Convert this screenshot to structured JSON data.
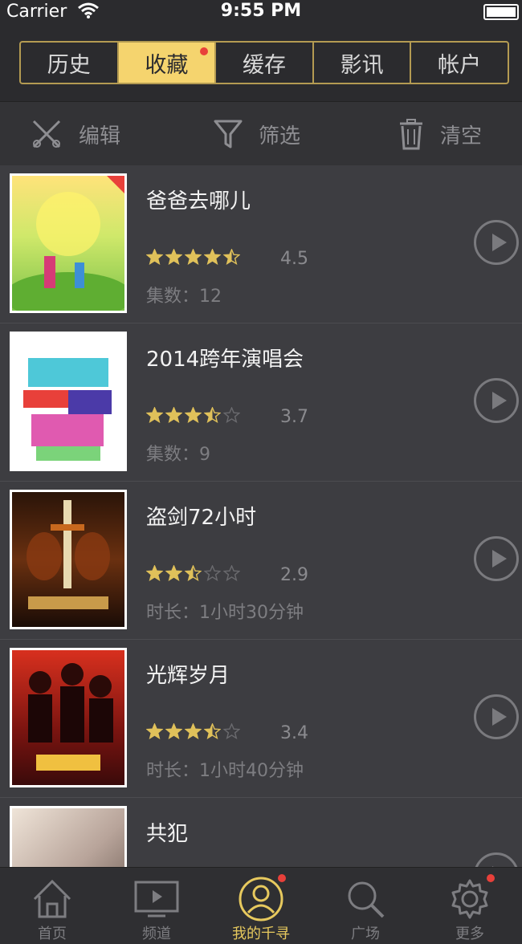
{
  "status_bar": {
    "carrier": "Carrier",
    "time": "9:55 PM"
  },
  "header_tabs": [
    {
      "label": "历史",
      "active": false,
      "badge": false
    },
    {
      "label": "收藏",
      "active": true,
      "badge": true
    },
    {
      "label": "缓存",
      "active": false,
      "badge": false
    },
    {
      "label": "影讯",
      "active": false,
      "badge": false
    },
    {
      "label": "帐户",
      "active": false,
      "badge": false
    }
  ],
  "toolbar": {
    "edit_label": "编辑",
    "filter_label": "筛选",
    "clear_label": "清空"
  },
  "items": [
    {
      "title": "爸爸去哪儿",
      "rating": "4.5",
      "stars": 4.5,
      "meta": "集数：12",
      "poster_icon": "poster-baba-qu-naer",
      "poster_colors": [
        "#7cc24a",
        "#ffe37a"
      ]
    },
    {
      "title": "2014跨年演唱会",
      "rating": "3.7",
      "stars": 3.5,
      "meta": "集数：9",
      "poster_icon": "poster-concert",
      "poster_colors": [
        "#ffffff",
        "#3fb3c8"
      ]
    },
    {
      "title": "盗剑72小时",
      "rating": "2.9",
      "stars": 2.5,
      "meta": "时长：1小时30分钟",
      "poster_icon": "poster-sword",
      "poster_colors": [
        "#1a0c06",
        "#c8681e"
      ]
    },
    {
      "title": "光辉岁月",
      "rating": "3.4",
      "stars": 3.5,
      "meta": "时长：1小时40分钟",
      "poster_icon": "poster-glory",
      "poster_colors": [
        "#b8231c",
        "#3a0a0a"
      ]
    },
    {
      "title": "共犯",
      "rating": "",
      "stars": 0,
      "meta": "",
      "poster_icon": "poster-accomplice",
      "poster_colors": [
        "#d8c8b8",
        "#5a4a42"
      ]
    }
  ],
  "tabbar": [
    {
      "label": "首页",
      "icon": "home-icon",
      "active": false,
      "badge": false
    },
    {
      "label": "频道",
      "icon": "tv-icon",
      "active": false,
      "badge": false
    },
    {
      "label": "我的千寻",
      "icon": "user-circle-icon",
      "active": true,
      "badge": true
    },
    {
      "label": "广场",
      "icon": "search-icon",
      "active": false,
      "badge": false
    },
    {
      "label": "更多",
      "icon": "gear-icon",
      "active": false,
      "badge": true
    }
  ],
  "colors": {
    "accent": "#f5d46e",
    "badge": "#e8403a",
    "star": "#e0c15a"
  }
}
